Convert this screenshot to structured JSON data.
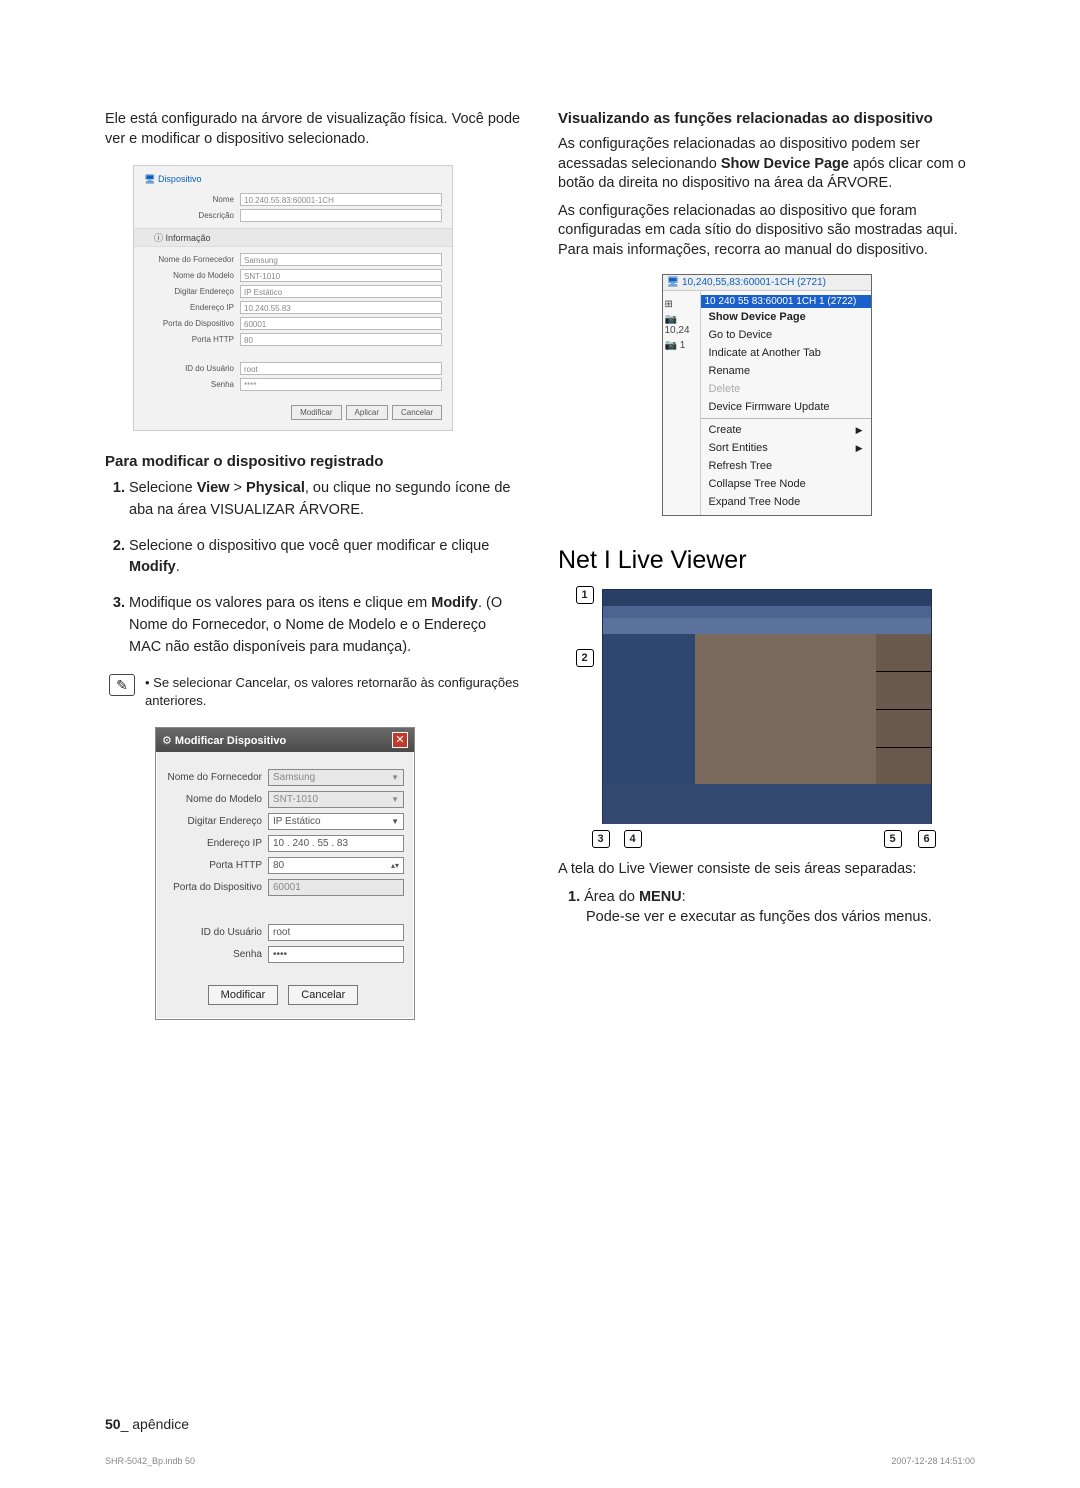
{
  "left": {
    "intro": "Ele está configurado na árvore de visualização física. Você pode ver e modificar o dispositivo selecionado.",
    "fig1": {
      "tab": "Dispositivo",
      "name_lab": "Nome",
      "name_val": "10.240.55.83:60001-1CH",
      "desc_lab": "Descrição",
      "section": "Informação",
      "rows": [
        {
          "lab": "Nome do Fornecedor",
          "val": "Samsung"
        },
        {
          "lab": "Nome do Modelo",
          "val": "SNT-1010"
        },
        {
          "lab": "Digitar Endereço",
          "val": "IP Estático"
        },
        {
          "lab": "Endereço IP",
          "val": "10.240.55.83"
        },
        {
          "lab": "Porta do Dispositivo",
          "val": "60001"
        },
        {
          "lab": "Porta HTTP",
          "val": "80"
        }
      ],
      "auth": [
        {
          "lab": "ID do Usuário",
          "val": "root"
        },
        {
          "lab": "Senha",
          "val": "****"
        }
      ],
      "btns": [
        "Modificar",
        "Aplicar",
        "Cancelar"
      ]
    },
    "h_modify": "Para modificar o dispositivo registrado",
    "steps": {
      "s1a": "Selecione ",
      "s1b": "View",
      "s1c": " > ",
      "s1d": "Physical",
      "s1e": ", ou clique no segundo ícone de aba na área VISUALIZAR ÁRVORE.",
      "s2a": "Selecione o dispositivo que você quer modificar e clique ",
      "s2b": "Modify",
      "s2c": ".",
      "s3a": "Modifique os valores para os itens e clique em ",
      "s3b": "Modify",
      "s3c": ". (O Nome do Fornecedor, o Nome de Modelo e o Endereço MAC não estão disponíveis para mudança)."
    },
    "note": "Se selecionar Cancelar, os valores retornarão às configurações anteriores.",
    "fig2": {
      "title": "Modificar Dispositivo",
      "rows": [
        {
          "lab": "Nome do Fornecedor",
          "val": "Samsung",
          "disabled": true,
          "dd": true
        },
        {
          "lab": "Nome do Modelo",
          "val": "SNT-1010",
          "disabled": true,
          "dd": true
        },
        {
          "lab": "Digitar Endereço",
          "val": "IP Estático",
          "dd": true
        },
        {
          "lab": "Endereço IP",
          "val": "10  .  240  .  55  .  83"
        },
        {
          "lab": "Porta HTTP",
          "val": "80",
          "spin": true
        },
        {
          "lab": "Porta do Dispositivo",
          "val": "60001",
          "disabled": true
        }
      ],
      "auth": [
        {
          "lab": "ID do Usuário",
          "val": "root"
        },
        {
          "lab": "Senha",
          "val": "••••"
        }
      ],
      "btns": [
        "Modificar",
        "Cancelar"
      ]
    }
  },
  "right": {
    "h_funcs": "Visualizando as funções relacionadas ao dispositivo",
    "p1": "As configurações relacionadas ao dispositivo podem ser acessadas selecionando ",
    "p1b": "Show Device Page",
    "p1c": " após clicar com o botão da direita no dispositivo na área da ÁRVORE.",
    "p2": "As configurações relacionadas ao dispositivo que foram configuradas em cada sítio do dispositivo são mostradas aqui. Para mais informações, recorra ao manual do dispositivo.",
    "ctx": {
      "title": "10,240,55,83:60001-1CH (2721)",
      "hl": "10 240 55 83:60001 1CH 1 (2722)",
      "side_a": "10,24",
      "side_b": "1",
      "items": [
        {
          "t": "Show Device Page",
          "sel": true
        },
        {
          "t": "Go to Device"
        },
        {
          "t": "Indicate at Another Tab"
        },
        {
          "t": "Rename"
        },
        {
          "t": "Delete",
          "disabled": true
        },
        {
          "t": "Device Firmware Update"
        },
        {
          "sep": true
        },
        {
          "t": "Create",
          "sub": true
        },
        {
          "t": "Sort Entities",
          "sub": true
        },
        {
          "t": "Refresh Tree"
        },
        {
          "t": "Collapse Tree Node"
        },
        {
          "t": "Expand Tree Node"
        }
      ]
    },
    "h_live": "Net I Live Viewer",
    "callouts": [
      "1",
      "2",
      "3",
      "4",
      "5",
      "6"
    ],
    "p_live": "A tela do Live Viewer consiste de seis áreas separadas:",
    "area1_num": "1.",
    "area1_a": " Área do ",
    "area1_b": "MENU",
    "area1_c": ":",
    "area1_body": "Pode-se ver e executar as funções dos vários menus."
  },
  "footer": {
    "page": "50",
    "label": "_ apêndice"
  },
  "subfooter": {
    "left": "SHR-5042_Bp.indb   50",
    "right": "2007-12-28   14:51:00"
  }
}
